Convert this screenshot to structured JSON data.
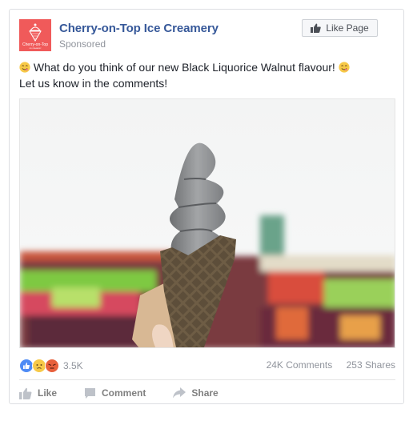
{
  "post": {
    "page_name": "Cherry-on-Top Ice Creamery",
    "sponsored_label": "Sponsored",
    "logo_text": "Cherry-on-Top",
    "like_page_label": "Like Page",
    "text_line1": "What do you think of our new Black Liquorice Walnut flavour!",
    "text_line2": "Let us know in the comments!",
    "photo_alt": "Black ice cream soft serve in a dark waffle cone held against a blurred fairground background"
  },
  "stats": {
    "reactions": [
      "like",
      "sad",
      "angry"
    ],
    "reaction_count": "3.5K",
    "comments": "24K Comments",
    "shares": "253 Shares"
  },
  "actions": [
    {
      "label": "Like",
      "icon": "thumbs-up-icon"
    },
    {
      "label": "Comment",
      "icon": "comment-icon"
    },
    {
      "label": "Share",
      "icon": "share-icon"
    }
  ],
  "colors": {
    "brand": "#365899",
    "logo_bg": "#f05a5a"
  }
}
